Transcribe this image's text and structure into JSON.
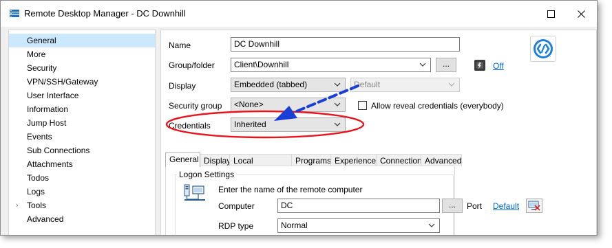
{
  "window": {
    "title": "Remote Desktop Manager - DC Downhill"
  },
  "titlebar_buttons": {
    "maximize": "maximize-icon",
    "close": "close-icon"
  },
  "sidebar": {
    "items": [
      {
        "label": "General",
        "selected": true
      },
      {
        "label": "More"
      },
      {
        "label": "Security"
      },
      {
        "label": "VPN/SSH/Gateway"
      },
      {
        "label": "User Interface"
      },
      {
        "label": "Information"
      },
      {
        "label": "Jump Host"
      },
      {
        "label": "Events"
      },
      {
        "label": "Sub Connections"
      },
      {
        "label": "Attachments"
      },
      {
        "label": "Todos"
      },
      {
        "label": "Logs"
      },
      {
        "label": "Tools",
        "expandable": true
      },
      {
        "label": "Advanced"
      }
    ]
  },
  "form": {
    "name_label": "Name",
    "name_value": "DC Downhill",
    "group_label": "Group/folder",
    "group_value": "Client\\Downhill",
    "browse_label": "...",
    "off_label": "Off",
    "display_label": "Display",
    "display_value": "Embedded (tabbed)",
    "display_sub_value": "Default",
    "security_group_label": "Security group",
    "security_group_value": "<None>",
    "allow_reveal_label": "Allow reveal credentials (everybody)",
    "allow_reveal_checked": false,
    "credentials_label": "Credentials",
    "credentials_value": "Inherited"
  },
  "tabs": [
    {
      "label": "General",
      "active": true
    },
    {
      "label": "Display"
    },
    {
      "label": "Local Resources"
    },
    {
      "label": "Programs"
    },
    {
      "label": "Experience"
    },
    {
      "label": "Connection"
    },
    {
      "label": "Advanced"
    }
  ],
  "logon": {
    "group_title": "Logon Settings",
    "instruction": "Enter the name of the remote computer",
    "computer_label": "Computer",
    "computer_value": "DC",
    "browse_label": "...",
    "port_label": "Port",
    "port_link": "Default",
    "rdp_type_label": "RDP type",
    "rdp_type_value": "Normal"
  },
  "colors": {
    "accent": "#0066cc",
    "selection": "#cce8ff",
    "annotation_red": "#e8141c",
    "annotation_blue": "#1a3fd6"
  }
}
